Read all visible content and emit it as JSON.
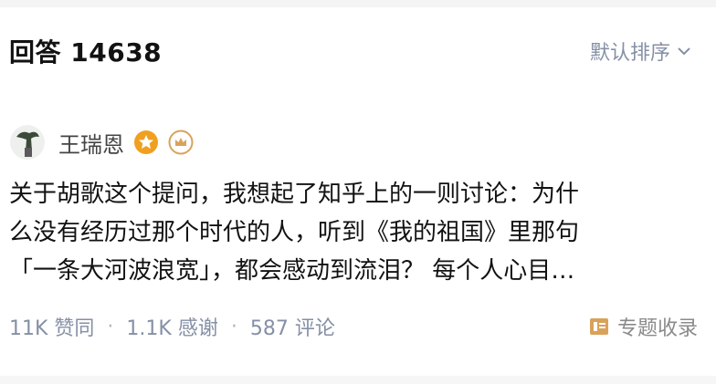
{
  "header": {
    "answers_label": "回答 14638",
    "sort_label": "默认排序"
  },
  "author": {
    "name": "王瑞恩",
    "accent_color": "#f0a020",
    "badge_color": "#d9a25a"
  },
  "answer": {
    "lines": [
      "关于胡歌这个提问，我想起了知乎上的一则讨论：为什",
      "么没有经历过那个时代的人，听到《我的祖国》里那句",
      "「一条大河波浪宽」，都会感动到流泪？ 每个人心目…"
    ]
  },
  "footer": {
    "upvotes": "11K 赞同",
    "separator": "·",
    "thanks": "1.1K 感谢",
    "comments": "587 评论",
    "collect_label": "专题收录",
    "collect_icon": "collection-icon"
  }
}
